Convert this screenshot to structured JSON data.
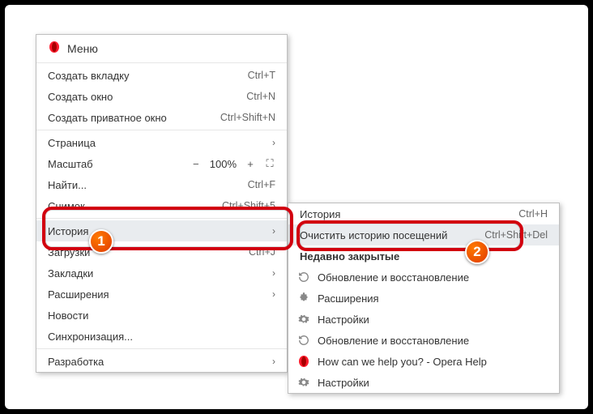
{
  "header": {
    "title": "Меню"
  },
  "mainMenu": {
    "items": [
      {
        "label": "Создать вкладку",
        "shortcut": "Ctrl+T"
      },
      {
        "label": "Создать окно",
        "shortcut": "Ctrl+N"
      },
      {
        "label": "Создать приватное окно",
        "shortcut": "Ctrl+Shift+N"
      }
    ],
    "page": {
      "label": "Страница"
    },
    "zoom": {
      "label": "Масштаб",
      "minus": "−",
      "value": "100%",
      "plus": "+",
      "expand": "⛶"
    },
    "find": {
      "label": "Найти...",
      "shortcut": "Ctrl+F"
    },
    "snapshot": {
      "label": "Снимок",
      "shortcut": "Ctrl+Shift+5"
    },
    "history": {
      "label": "История"
    },
    "downloads": {
      "label": "Загрузки",
      "shortcut": "Ctrl+J"
    },
    "bookmarks": {
      "label": "Закладки"
    },
    "extensions": {
      "label": "Расширения"
    },
    "news": {
      "label": "Новости"
    },
    "sync": {
      "label": "Синхронизация..."
    },
    "dev": {
      "label": "Разработка"
    }
  },
  "subMenu": {
    "history": {
      "label": "История",
      "shortcut": "Ctrl+H"
    },
    "clear": {
      "label": "Очистить историю посещений",
      "shortcut": "Ctrl+Shift+Del"
    },
    "recent": {
      "label": "Недавно закрытые"
    },
    "items": [
      {
        "icon": "refresh",
        "label": "Обновление и восстановление"
      },
      {
        "icon": "puzzle",
        "label": "Расширения"
      },
      {
        "icon": "gear",
        "label": "Настройки"
      },
      {
        "icon": "refresh",
        "label": "Обновление и восстановление"
      },
      {
        "icon": "opera",
        "label": "How can we help you? - Opera Help"
      },
      {
        "icon": "gear",
        "label": "Настройки"
      }
    ]
  },
  "badges": {
    "one": "1",
    "two": "2"
  }
}
